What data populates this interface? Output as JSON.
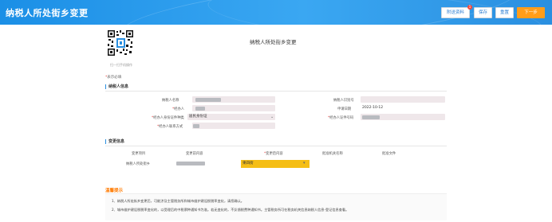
{
  "header": {
    "title": "纳税人所处街乡变更",
    "buttons": {
      "attachment": "附送资料",
      "attachment_badge": "1",
      "save": "保存",
      "reset": "重置",
      "next": "下一步"
    }
  },
  "qr": {
    "caption": "扫一扫手机操作"
  },
  "form": {
    "title": "纳税人所处街乡变更",
    "required_note": "表示必填"
  },
  "taxpayer_section": {
    "title": "纳税人信息",
    "fields": {
      "taxpayer_name_label": "纳税人名称",
      "taxpayer_id_label": "纳税人识别号",
      "handler_label": "经办人",
      "apply_date_label": "申请日期",
      "apply_date_value": "2022-10-12",
      "handler_id_type_label": "经办人身份证件种类",
      "handler_id_type_value": "居民身份证",
      "handler_id_no_label": "经办人证件号码",
      "handler_contact_label": "经办人联系方式"
    }
  },
  "change_section": {
    "title": "变更信息",
    "columns": [
      "变更项目",
      "变更前内容",
      "变更后内容",
      "批准机关名称",
      "批准文件"
    ],
    "row": {
      "item": "纳税人所处街乡",
      "after_value": "東四街"
    }
  },
  "tips": {
    "title": "温馨提示",
    "items": [
      "1、纳税人所处街乡变更后，可能涉及主管税务所和城市维护建设税税率变化，请您确认。",
      "2、城市维护建设税税率变化的，以受理后的中税票种通知书为准。若无变化的，不反馈税费种通知书。主管税务所可在税务机关信息纳税人信息-登记信息查看。"
    ]
  },
  "colors": {
    "header_blue": "#2a8fe0",
    "primary_orange": "#ff9d1a",
    "field_bg": "#efe7ea",
    "highlight_yellow": "#f5be15",
    "tips_orange": "#ff7a00"
  }
}
